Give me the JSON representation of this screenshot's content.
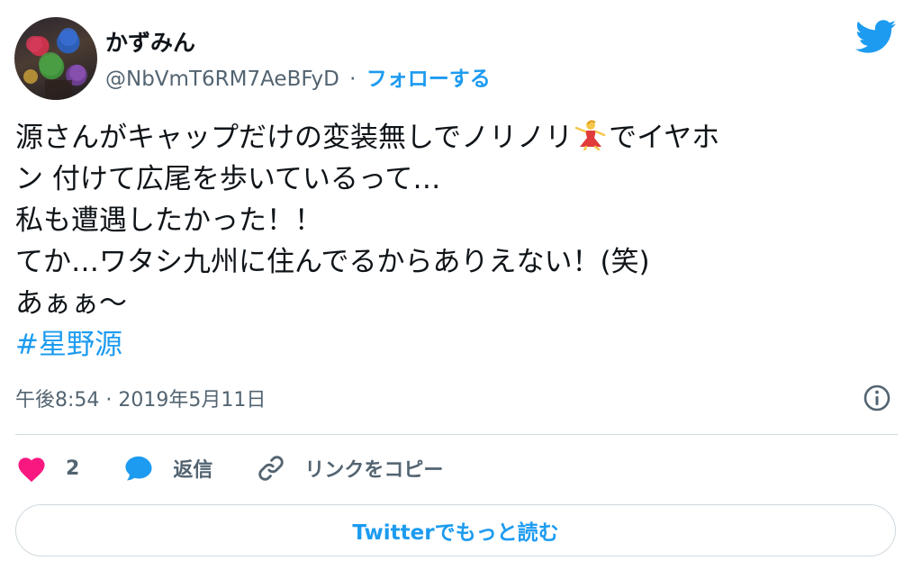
{
  "author": {
    "display_name": "かずみん",
    "handle": "@NbVmT6RM7AeBFyD",
    "separator": "·",
    "follow_label": "フォローする"
  },
  "tweet": {
    "line1_before_emoji": "源さんがキャップだけの変装無しでノリノリ",
    "line1_emoji": "dancer-emoji",
    "line1_after_emoji": "でイヤホ",
    "line2": "ン 付けて広尾を歩いているって…",
    "line3": "私も遭遇したかった！！",
    "line4": "てか…ワタシ九州に住んでるからありえない！(笑)",
    "line5": "あぁぁ〜",
    "hashtag": "#星野源"
  },
  "meta": {
    "timestamp": "午後8:54 · 2019年5月11日"
  },
  "actions": {
    "like_count": "2",
    "reply_label": "返信",
    "copy_link_label": "リンクをコピー"
  },
  "read_more_label": "Twitterでもっと読む",
  "icons": {
    "brand": "twitter-bird-icon",
    "info": "info-icon",
    "like": "heart-icon",
    "reply": "speech-bubble-icon",
    "link": "link-icon"
  },
  "colors": {
    "accent": "#1d9bf0",
    "like": "#f91880",
    "muted": "#536471",
    "text": "#0f1419",
    "border": "#cfd9de"
  }
}
